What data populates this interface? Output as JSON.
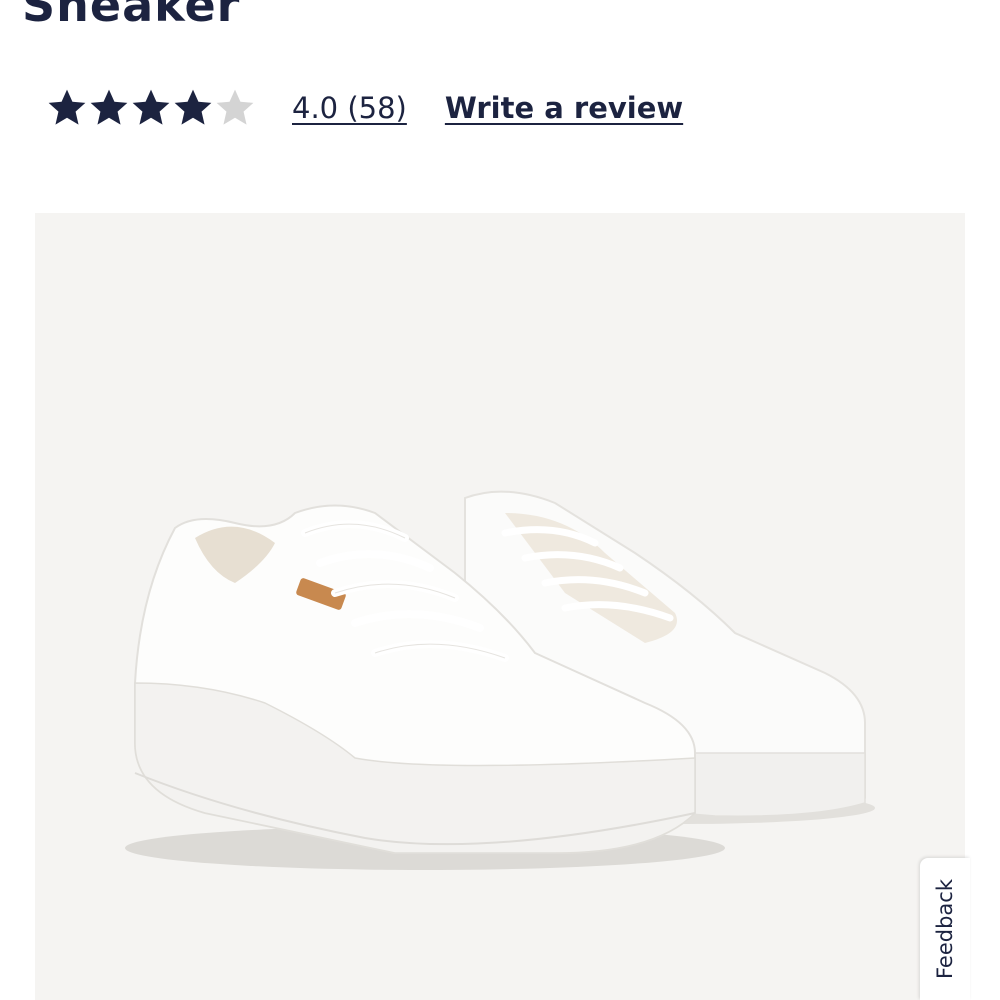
{
  "product": {
    "title": "Sneaker",
    "rating_value": 4.0,
    "rating_display": "4.0 (58)",
    "review_count": 58,
    "write_review_label": "Write a review",
    "stars_filled": 4,
    "stars_total": 5,
    "image_alt_icon": "white-platform-sneaker-image"
  },
  "feedback": {
    "label": "Feedback"
  },
  "colors": {
    "navy": "#1c2340",
    "star_empty": "#d4d4d4",
    "image_background": "#f5f4f2",
    "brand_tab": "#c8894f"
  }
}
